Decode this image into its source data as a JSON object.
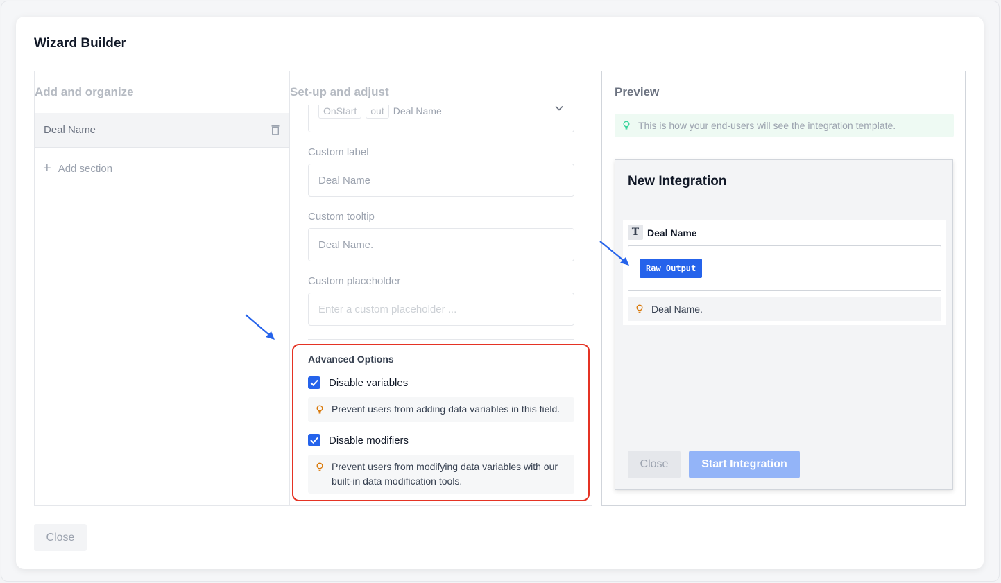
{
  "modal": {
    "title": "Wizard Builder"
  },
  "left": {
    "heading": "Add and organize",
    "section_item": "Deal Name",
    "add_section": "Add section"
  },
  "middle": {
    "heading": "Set-up and adjust",
    "source_chips": [
      "OnStart",
      "out"
    ],
    "source_value": "Deal Name",
    "custom_label": {
      "label": "Custom label",
      "value": "Deal Name"
    },
    "custom_tooltip": {
      "label": "Custom tooltip",
      "value": "Deal Name."
    },
    "custom_placeholder": {
      "label": "Custom placeholder",
      "placeholder": "Enter a custom placeholder ..."
    },
    "advanced": {
      "title": "Advanced Options",
      "disable_variables": {
        "label": "Disable variables",
        "checked": true,
        "hint": "Prevent users from adding data variables in this field."
      },
      "disable_modifiers": {
        "label": "Disable modifiers",
        "checked": true,
        "hint": "Prevent users from modifying data variables with our built-in data modification tools."
      }
    }
  },
  "preview": {
    "heading": "Preview",
    "note": "This is how your end-users will see the integration template.",
    "window_title": "New Integration",
    "field_label": "Deal Name",
    "field_type_icon": "T",
    "raw_output_chip": "Raw Output",
    "field_hint": "Deal Name.",
    "close_label": "Close",
    "start_label": "Start Integration"
  },
  "footer": {
    "close_label": "Close"
  },
  "colors": {
    "accent": "#2563eb",
    "highlight": "#e53324",
    "hint_bulb": "#d97706",
    "note_bulb": "#34d399"
  }
}
